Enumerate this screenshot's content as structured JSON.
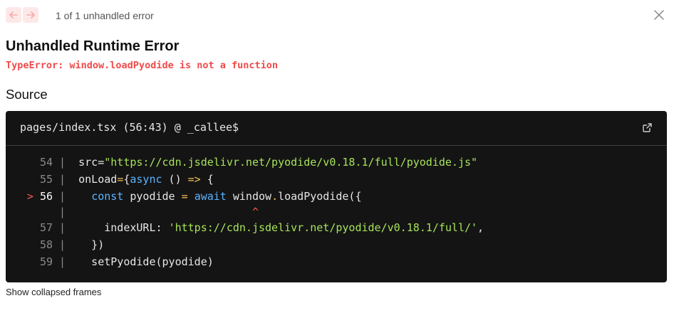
{
  "nav": {
    "prev_icon": "arrow-left-icon",
    "next_icon": "arrow-right-icon",
    "counter_text": "1 of 1 unhandled error"
  },
  "error": {
    "title": "Unhandled Runtime Error",
    "message": "TypeError: window.loadPyodide is not a function"
  },
  "source": {
    "heading": "Source",
    "file_ref": "pages/index.tsx (56:43) @ _callee$",
    "lines": [
      {
        "num": "54",
        "marker": "",
        "text": " src=\"https://cdn.jsdelivr.net/pyodide/v0.18.1/full/pyodide.js\""
      },
      {
        "num": "55",
        "marker": "",
        "text": " onLoad={async () => {"
      },
      {
        "num": "56",
        "marker": ">",
        "text": "   const pyodide = await window.loadPyodide({"
      },
      {
        "num": "",
        "marker": "",
        "text": ""
      },
      {
        "num": "57",
        "marker": "",
        "text": "     indexURL: 'https://cdn.jsdelivr.net/pyodide/v0.18.1/full/',"
      },
      {
        "num": "58",
        "marker": "",
        "text": "   })"
      },
      {
        "num": "59",
        "marker": "",
        "text": "   setPyodide(pyodide)"
      }
    ]
  },
  "footer": {
    "collapsed_label": "Show collapsed frames"
  },
  "colors": {
    "error_red": "#f04a4a",
    "code_bg": "#141414",
    "string_green": "#a6e35a",
    "keyword_blue": "#5ab4ff",
    "operator_yellow": "#f2c14e"
  }
}
